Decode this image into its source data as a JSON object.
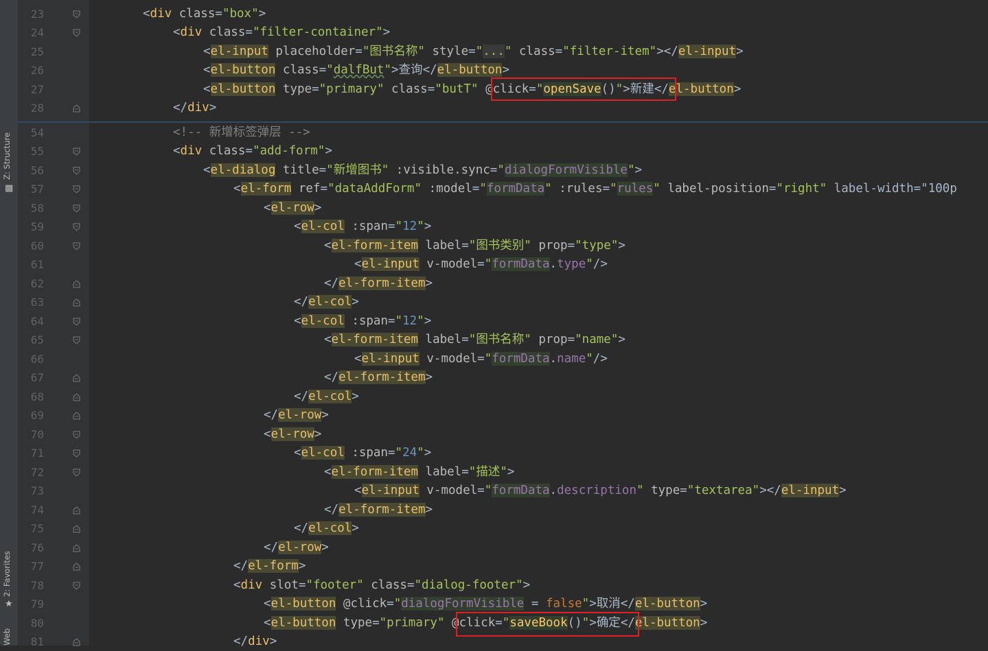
{
  "sidebar": {
    "structure_label": "Z: Structure",
    "favorites_label": "2: Favorites",
    "web_label": "Web"
  },
  "colors": {
    "background": "#2b2b2b",
    "gutter": "#313335",
    "tag": "#e8bf6a",
    "string": "#a5c25c",
    "highlight_box": "#e02020"
  },
  "lines": [
    {
      "n": "23",
      "text": "<div class=\"box\">"
    },
    {
      "n": "24",
      "text": "<div class=\"filter-container\">"
    },
    {
      "n": "25",
      "text": "<el-input placeholder=\"图书名称\" style=\"...\" class=\"filter-item\"></el-input>"
    },
    {
      "n": "26",
      "text": "<el-button class=\"dalfBut\">查询</el-button>"
    },
    {
      "n": "27",
      "text": "<el-button type=\"primary\" class=\"butT\" @click=\"openSave()\">新建</el-button>"
    },
    {
      "n": "28",
      "text": "</div>"
    },
    {
      "n": "54",
      "text": "<!-- 新增标签弹层 -->"
    },
    {
      "n": "55",
      "text": "<div class=\"add-form\">"
    },
    {
      "n": "56",
      "text": "<el-dialog title=\"新增图书\" :visible.sync=\"dialogFormVisible\">"
    },
    {
      "n": "57",
      "text": "<el-form ref=\"dataAddForm\" :model=\"formData\" :rules=\"rules\" label-position=\"right\" label-width=\"100p"
    },
    {
      "n": "58",
      "text": "<el-row>"
    },
    {
      "n": "59",
      "text": "<el-col :span=\"12\">"
    },
    {
      "n": "60",
      "text": "<el-form-item label=\"图书类别\" prop=\"type\">"
    },
    {
      "n": "61",
      "text": "<el-input v-model=\"formData.type\"/>"
    },
    {
      "n": "62",
      "text": "</el-form-item>"
    },
    {
      "n": "63",
      "text": "</el-col>"
    },
    {
      "n": "64",
      "text": "<el-col :span=\"12\">"
    },
    {
      "n": "65",
      "text": "<el-form-item label=\"图书名称\" prop=\"name\">"
    },
    {
      "n": "66",
      "text": "<el-input v-model=\"formData.name\"/>"
    },
    {
      "n": "67",
      "text": "</el-form-item>"
    },
    {
      "n": "68",
      "text": "</el-col>"
    },
    {
      "n": "69",
      "text": "</el-row>"
    },
    {
      "n": "70",
      "text": "<el-row>"
    },
    {
      "n": "71",
      "text": "<el-col :span=\"24\">"
    },
    {
      "n": "72",
      "text": "<el-form-item label=\"描述\">"
    },
    {
      "n": "73",
      "text": "<el-input v-model=\"formData.description\" type=\"textarea\"></el-input>"
    },
    {
      "n": "74",
      "text": "</el-form-item>"
    },
    {
      "n": "75",
      "text": "</el-col>"
    },
    {
      "n": "76",
      "text": "</el-row>"
    },
    {
      "n": "77",
      "text": "</el-form>"
    },
    {
      "n": "78",
      "text": "<div slot=\"footer\" class=\"dialog-footer\">"
    },
    {
      "n": "79",
      "text": "<el-button @click=\"dialogFormVisible = false\">取消</el-button>"
    },
    {
      "n": "80",
      "text": "<el-button type=\"primary\" @click=\"saveBook()\">确定</el-button>"
    },
    {
      "n": "81",
      "text": "</div>"
    }
  ]
}
